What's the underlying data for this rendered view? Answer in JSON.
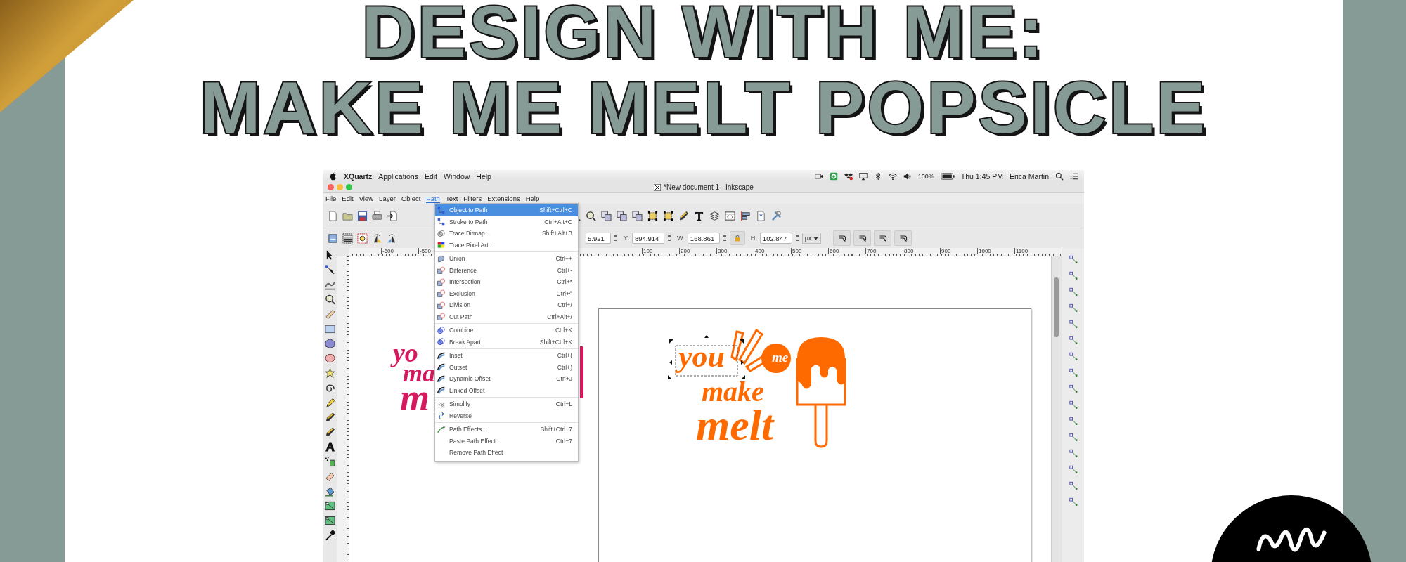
{
  "title": {
    "lines": [
      "DESIGN WITH ME:",
      "MAKE ME MELT POPSICLE"
    ]
  },
  "screenshot": {
    "mac_menu_bar": {
      "app": "XQuartz",
      "menus": [
        "Applications",
        "Edit",
        "Window",
        "Help"
      ],
      "battery": "100%",
      "clock": "Thu 1:45 PM",
      "user": "Erica Martin"
    },
    "window": {
      "title": "*New document 1 - Inkscape"
    },
    "menu_bar": [
      {
        "label": "File",
        "selected": false
      },
      {
        "label": "Edit",
        "selected": false
      },
      {
        "label": "View",
        "selected": false
      },
      {
        "label": "Layer",
        "selected": false
      },
      {
        "label": "Object",
        "selected": false
      },
      {
        "label": "Path",
        "selected": true
      },
      {
        "label": "Text",
        "selected": false
      },
      {
        "label": "Filters",
        "selected": false
      },
      {
        "label": "Extensions",
        "selected": false
      },
      {
        "label": "Help",
        "selected": false
      }
    ],
    "dimensions": {
      "x_value": "5.921",
      "fields": [
        {
          "label": "Y:",
          "value": "894.914"
        },
        {
          "label": "W:",
          "value": "168.861"
        }
      ],
      "h_label": "H:",
      "h_value": "102.847",
      "unit": "px"
    },
    "ruler": {
      "left_labels": [
        "-600",
        "-500"
      ],
      "right_labels": [
        "100",
        "200",
        "300",
        "400",
        "500",
        "600",
        "700",
        "800",
        "900",
        "1000",
        "1100"
      ]
    },
    "path_menu": {
      "groups": [
        {
          "items": [
            {
              "label": "Object to Path",
              "shortcut": "Shift+Ctrl+C",
              "selected": true
            },
            {
              "label": "Stroke to Path",
              "shortcut": "Ctrl+Alt+C",
              "selected": false
            },
            {
              "label": "Trace Bitmap...",
              "shortcut": "Shift+Alt+B",
              "selected": false
            },
            {
              "label": "Trace Pixel Art...",
              "selected": false
            }
          ]
        },
        {
          "items": [
            {
              "label": "Union",
              "shortcut": "Ctrl++",
              "selected": false
            },
            {
              "label": "Difference",
              "shortcut": "Ctrl+-",
              "selected": false
            },
            {
              "label": "Intersection",
              "shortcut": "Ctrl+*",
              "selected": false
            },
            {
              "label": "Exclusion",
              "shortcut": "Ctrl+^",
              "selected": false
            },
            {
              "label": "Division",
              "shortcut": "Ctrl+/",
              "selected": false
            },
            {
              "label": "Cut Path",
              "shortcut": "Ctrl+Alt+/",
              "selected": false
            }
          ]
        },
        {
          "items": [
            {
              "label": "Combine",
              "shortcut": "Ctrl+K",
              "selected": false
            },
            {
              "label": "Break Apart",
              "shortcut": "Shift+Ctrl+K",
              "selected": false
            }
          ]
        },
        {
          "items": [
            {
              "label": "Inset",
              "shortcut": "Ctrl+(",
              "selected": false
            },
            {
              "label": "Outset",
              "shortcut": "Ctrl+)",
              "selected": false
            },
            {
              "label": "Dynamic Offset",
              "shortcut": "Ctrl+J",
              "selected": false
            },
            {
              "label": "Linked Offset",
              "selected": false
            }
          ]
        },
        {
          "items": [
            {
              "label": "Simplify",
              "shortcut": "Ctrl+L",
              "selected": false
            },
            {
              "label": "Reverse",
              "selected": false
            }
          ]
        },
        {
          "items": [
            {
              "label": "Path Effects ...",
              "shortcut": "Shift+Ctrl+7",
              "selected": false
            },
            {
              "label": "Paste Path Effect",
              "shortcut": "Ctrl+7",
              "selected": false
            },
            {
              "label": "Remove Path Effect",
              "selected": false
            }
          ]
        }
      ]
    },
    "canvas": {
      "pink_design": {
        "lines": [
          "yo",
          "ma",
          "m"
        ]
      },
      "orange_design": {
        "lines": [
          "you",
          "make",
          "melt"
        ],
        "badge": "me"
      }
    }
  }
}
